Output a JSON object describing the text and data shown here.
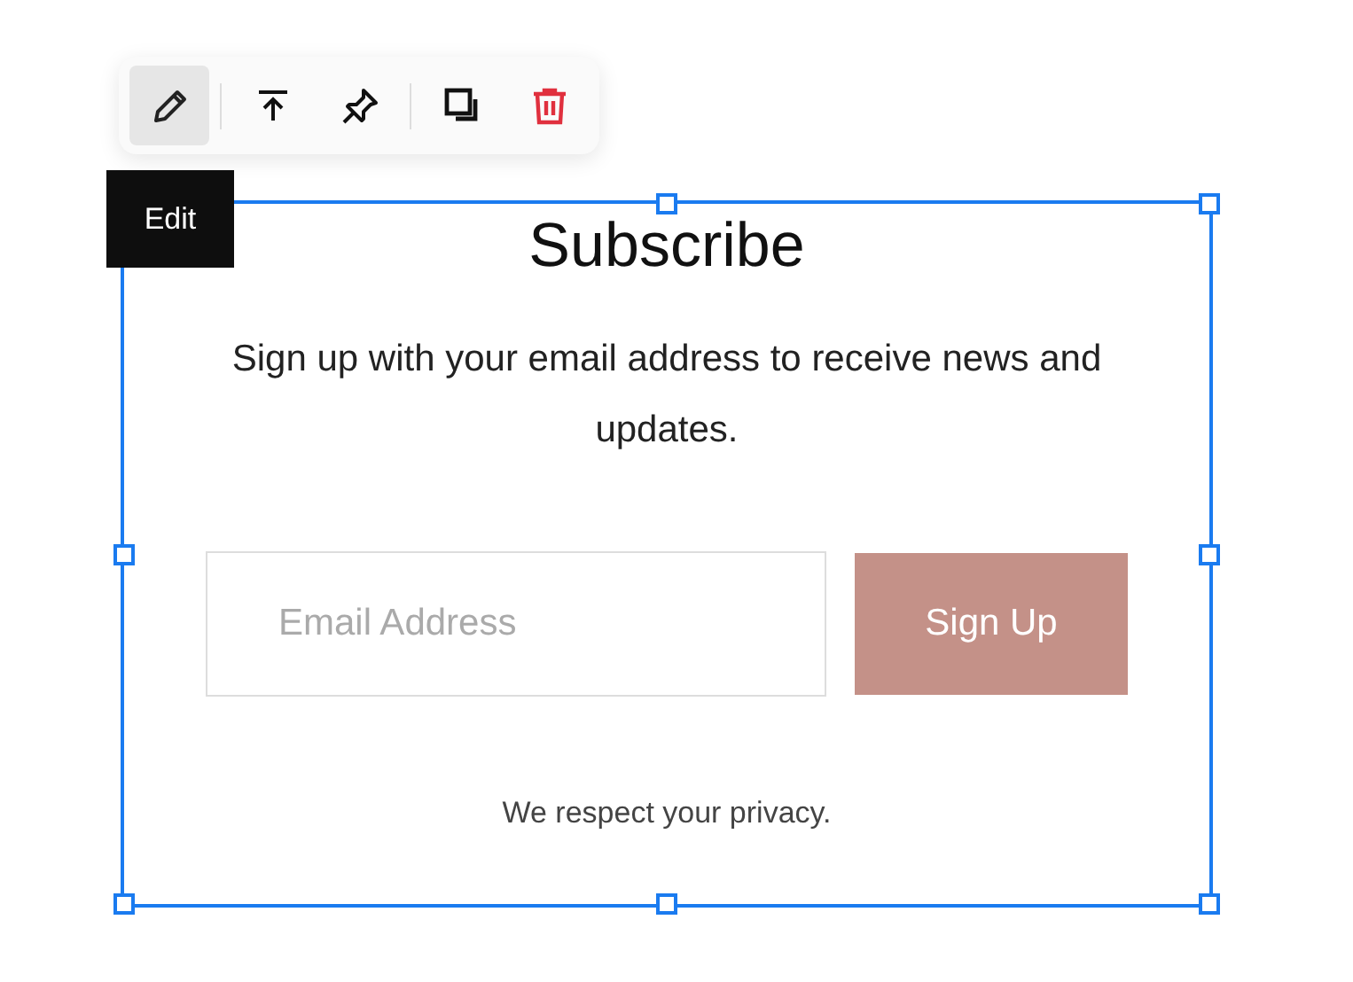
{
  "toolbar": {
    "buttons": [
      {
        "kind": "edit",
        "selected": true
      },
      {
        "kind": "move-top",
        "selected": false
      },
      {
        "kind": "pin",
        "selected": false
      },
      {
        "kind": "duplicate",
        "selected": false
      },
      {
        "kind": "delete",
        "selected": false
      }
    ]
  },
  "tooltip": "Edit",
  "block": {
    "title": "Subscribe",
    "description": "Sign up with your email address to receive news and updates.",
    "email": {
      "placeholder": "Email Address"
    },
    "button": "Sign Up",
    "note": "We respect your privacy."
  }
}
